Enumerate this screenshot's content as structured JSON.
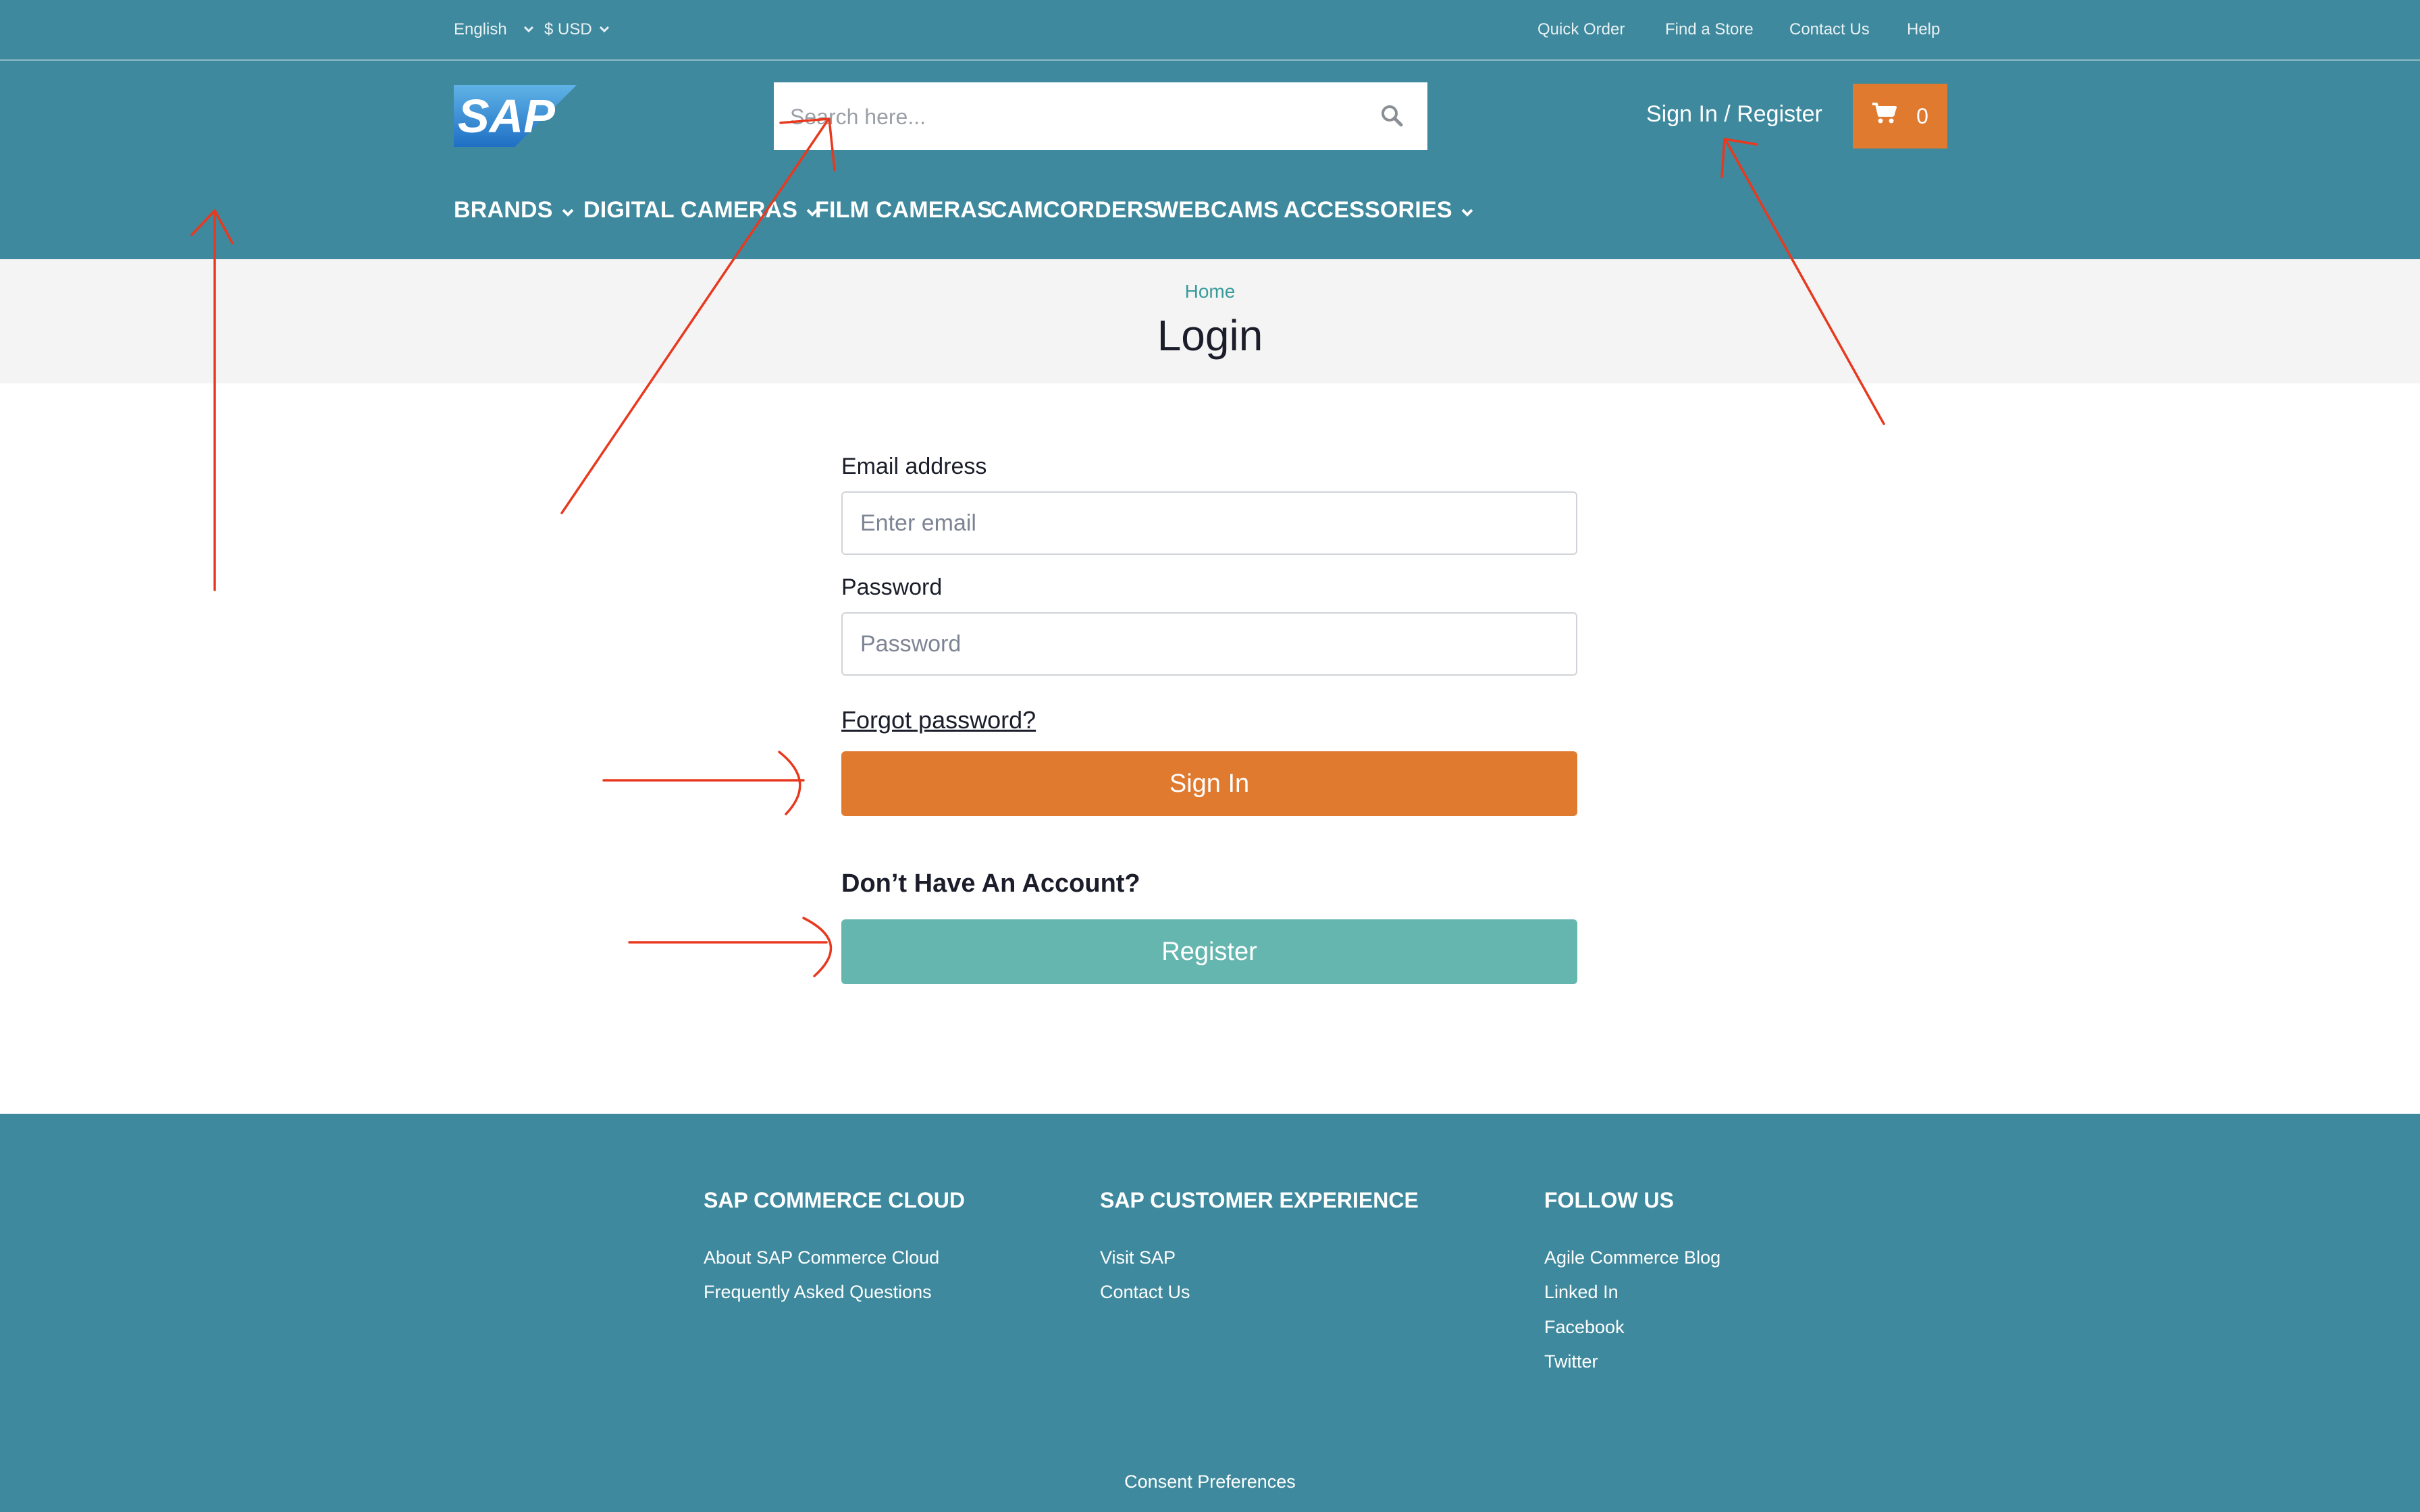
{
  "topbar": {
    "language": "English",
    "currency": "$ USD",
    "links": [
      "Quick Order",
      "Find a Store",
      "Contact Us",
      "Help"
    ]
  },
  "header": {
    "logo_text": "SAP",
    "search_placeholder": "Search here...",
    "signin_label": "Sign In / Register",
    "cart_count": "0",
    "nav": [
      "BRANDS",
      "DIGITAL CAMERAS",
      "FILM CAMERAS",
      "CAMCORDERS",
      "WEBCAMS",
      "ACCESSORIES"
    ]
  },
  "breadcrumb": {
    "home": "Home"
  },
  "page_title": "Login",
  "form": {
    "email_label": "Email address",
    "email_placeholder": "Enter email",
    "password_label": "Password",
    "password_placeholder": "Password",
    "forgot_label": "Forgot password?",
    "signin_button": "Sign In",
    "no_account_heading": "Don’t Have An Account?",
    "register_button": "Register"
  },
  "footer": {
    "columns": [
      {
        "heading": "SAP COMMERCE CLOUD",
        "links": [
          "About SAP Commerce Cloud",
          "Frequently Asked Questions"
        ]
      },
      {
        "heading": "SAP CUSTOMER EXPERIENCE",
        "links": [
          "Visit SAP",
          "Contact Us"
        ]
      },
      {
        "heading": "FOLLOW US",
        "links": [
          "Agile Commerce Blog",
          "Linked In",
          "Facebook",
          "Twitter"
        ]
      }
    ],
    "consent": "Consent Preferences"
  },
  "colors": {
    "header_bg": "#3e899d",
    "accent_orange": "#e07a2f",
    "register_teal": "#66b6b0",
    "annotation_red": "#e8391f"
  },
  "icons": [
    "chevron-down-icon",
    "search-icon",
    "cart-icon",
    "sap-logo"
  ]
}
